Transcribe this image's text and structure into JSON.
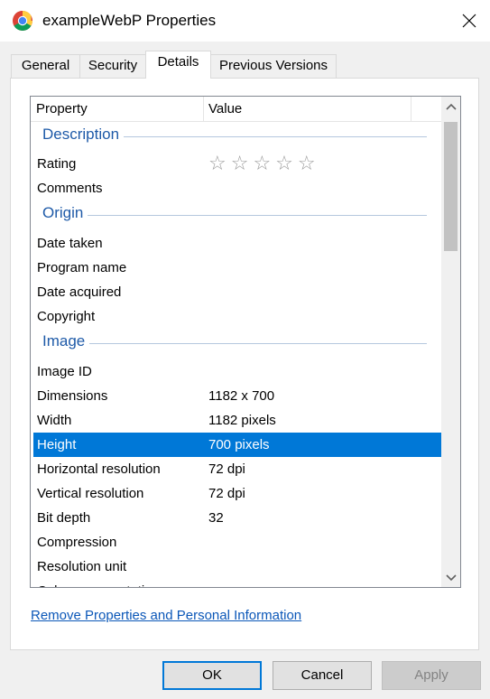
{
  "window": {
    "title": "exampleWebP Properties",
    "app_icon": "chrome-icon",
    "close_icon": "close-icon"
  },
  "tabs": [
    {
      "label": "General",
      "active": false
    },
    {
      "label": "Security",
      "active": false
    },
    {
      "label": "Details",
      "active": true
    },
    {
      "label": "Previous Versions",
      "active": false
    }
  ],
  "list": {
    "columns": {
      "property": "Property",
      "value": "Value"
    },
    "groups": {
      "description": "Description",
      "origin": "Origin",
      "image": "Image"
    },
    "rows": {
      "rating": {
        "property": "Rating",
        "stars_filled": 0,
        "stars_total": 5,
        "stars_text": "☆☆☆☆☆"
      },
      "comments": {
        "property": "Comments",
        "value": ""
      },
      "date_taken": {
        "property": "Date taken",
        "value": ""
      },
      "program_name": {
        "property": "Program name",
        "value": ""
      },
      "date_acquired": {
        "property": "Date acquired",
        "value": ""
      },
      "copyright": {
        "property": "Copyright",
        "value": ""
      },
      "image_id": {
        "property": "Image ID",
        "value": ""
      },
      "dimensions": {
        "property": "Dimensions",
        "value": "1182 x 700"
      },
      "width": {
        "property": "Width",
        "value": "1182 pixels"
      },
      "height": {
        "property": "Height",
        "value": "700 pixels",
        "selected": true
      },
      "horizontal_resolution": {
        "property": "Horizontal resolution",
        "value": "72 dpi"
      },
      "vertical_resolution": {
        "property": "Vertical resolution",
        "value": "72 dpi"
      },
      "bit_depth": {
        "property": "Bit depth",
        "value": "32"
      },
      "compression": {
        "property": "Compression",
        "value": ""
      },
      "resolution_unit": {
        "property": "Resolution unit",
        "value": ""
      },
      "color_representation": {
        "property": "Color representation",
        "value": ""
      }
    }
  },
  "link": {
    "remove_properties": "Remove Properties and Personal Information"
  },
  "buttons": {
    "ok": "OK",
    "cancel": "Cancel",
    "apply": "Apply"
  },
  "colors": {
    "selection": "#0078d7",
    "group_label": "#1e5aa8",
    "link": "#0b57b8"
  }
}
